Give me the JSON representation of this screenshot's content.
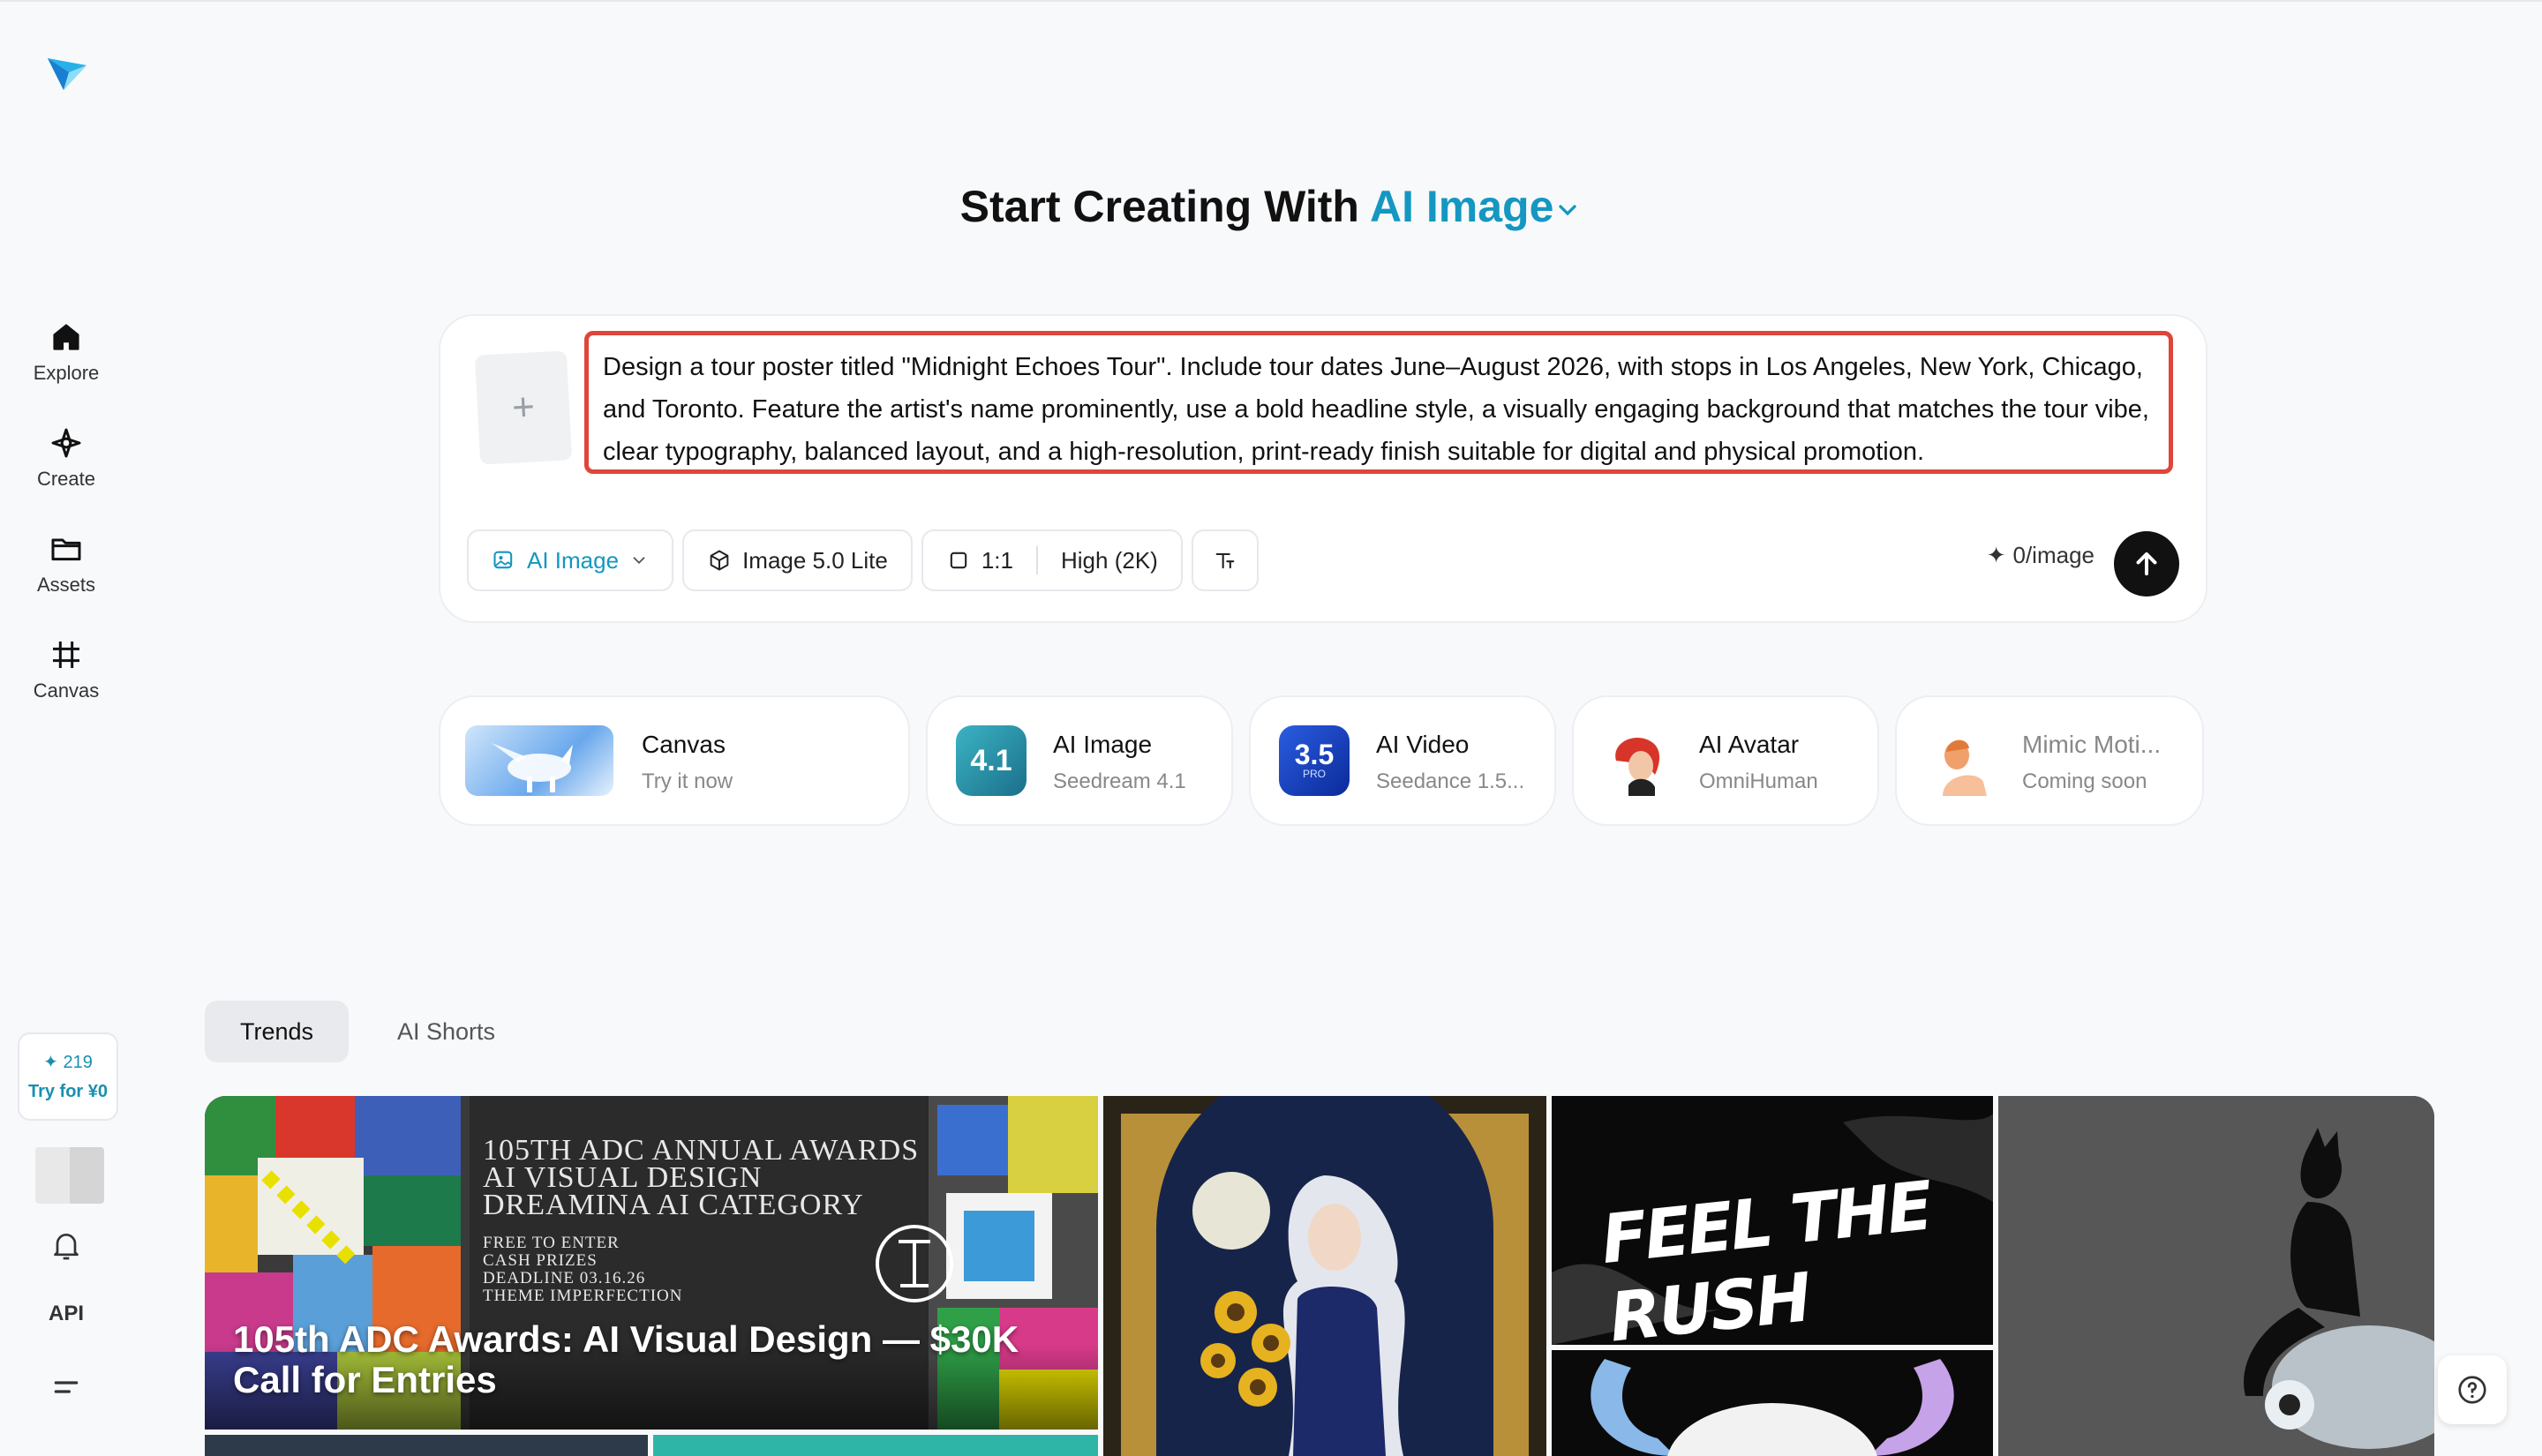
{
  "sidebar": {
    "items": [
      {
        "label": "Explore",
        "icon": "home-icon"
      },
      {
        "label": "Create",
        "icon": "sparkle-icon"
      },
      {
        "label": "Assets",
        "icon": "folder-icon"
      },
      {
        "label": "Canvas",
        "icon": "crop-icon"
      }
    ],
    "credits": "219",
    "try_label": "Try for ¥0",
    "api_label": "API"
  },
  "heading": {
    "prefix": "Start Creating With",
    "mode": "AI Image"
  },
  "prompt": {
    "upload_plus": "+",
    "text": "Design a tour poster titled \"Midnight Echoes Tour\". Include tour dates June–August 2026, with stops in Los Angeles, New York, Chicago, and Toronto. Feature the artist's name prominently, use a bold headline style, a visually engaging background that matches the tour vibe, clear typography, balanced layout, and a high-resolution, print-ready finish suitable for digital and physical promotion.",
    "toolbar": {
      "mode": "AI Image",
      "model": "Image 5.0 Lite",
      "ratio": "1:1",
      "quality": "High (2K)"
    },
    "cost": "0/image"
  },
  "features": [
    {
      "title": "Canvas",
      "sub": "Try it now"
    },
    {
      "title": "AI Image",
      "sub": "Seedream 4.1",
      "badge": "4.1"
    },
    {
      "title": "AI Video",
      "sub": "Seedance 1.5...",
      "badge": "3.5",
      "badge_sub": "PRO"
    },
    {
      "title": "AI Avatar",
      "sub": "OmniHuman"
    },
    {
      "title": "Mimic Moti...",
      "sub": "Coming soon"
    }
  ],
  "tabs": [
    "Trends",
    "AI Shorts"
  ],
  "gallery": {
    "banner_title": "105th ADC Awards: AI Visual Design — $30K Call for Entries",
    "banner_lines": [
      "105TH ADC ANNUAL AWARDS",
      "AI VISUAL DESIGN",
      "DREAMINA AI CATEGORY"
    ],
    "banner_small": [
      "FREE TO ENTER",
      "CASH PRIZES",
      "DEADLINE 03.16.26",
      "THEME IMPERFECTION"
    ],
    "rush_text": "FEEL THE RUSH"
  },
  "colors": {
    "accent": "#1497c0",
    "highlight_border": "#e0453a",
    "send_button": "#111111"
  }
}
